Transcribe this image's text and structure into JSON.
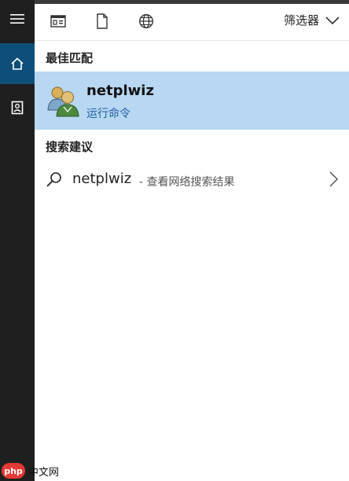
{
  "toolbar": {
    "filter_label": "筛选器",
    "icons": [
      "apps-icon",
      "document-icon",
      "globe-icon",
      "chevron-down-icon"
    ]
  },
  "rail": {
    "icons": [
      "hamburger-menu-icon",
      "home-icon",
      "notebook-icon"
    ],
    "active": "home-icon"
  },
  "best_match": {
    "title": "最佳匹配",
    "name": "netplwiz",
    "subtitle": "运行命令",
    "icon": "users-icon"
  },
  "suggestions": {
    "title": "搜索建议",
    "items": [
      {
        "term": "netplwiz",
        "hint": "- 查看网络搜索结果",
        "icon": "search-icon"
      }
    ]
  },
  "watermark": {
    "badge": "php",
    "text": "中文网"
  },
  "colors": {
    "rail_bg": "#1f1f1f",
    "rail_active": "#0e4f7a",
    "highlight": "#b7d7f2",
    "subtitle_blue": "#1f5fa3"
  }
}
